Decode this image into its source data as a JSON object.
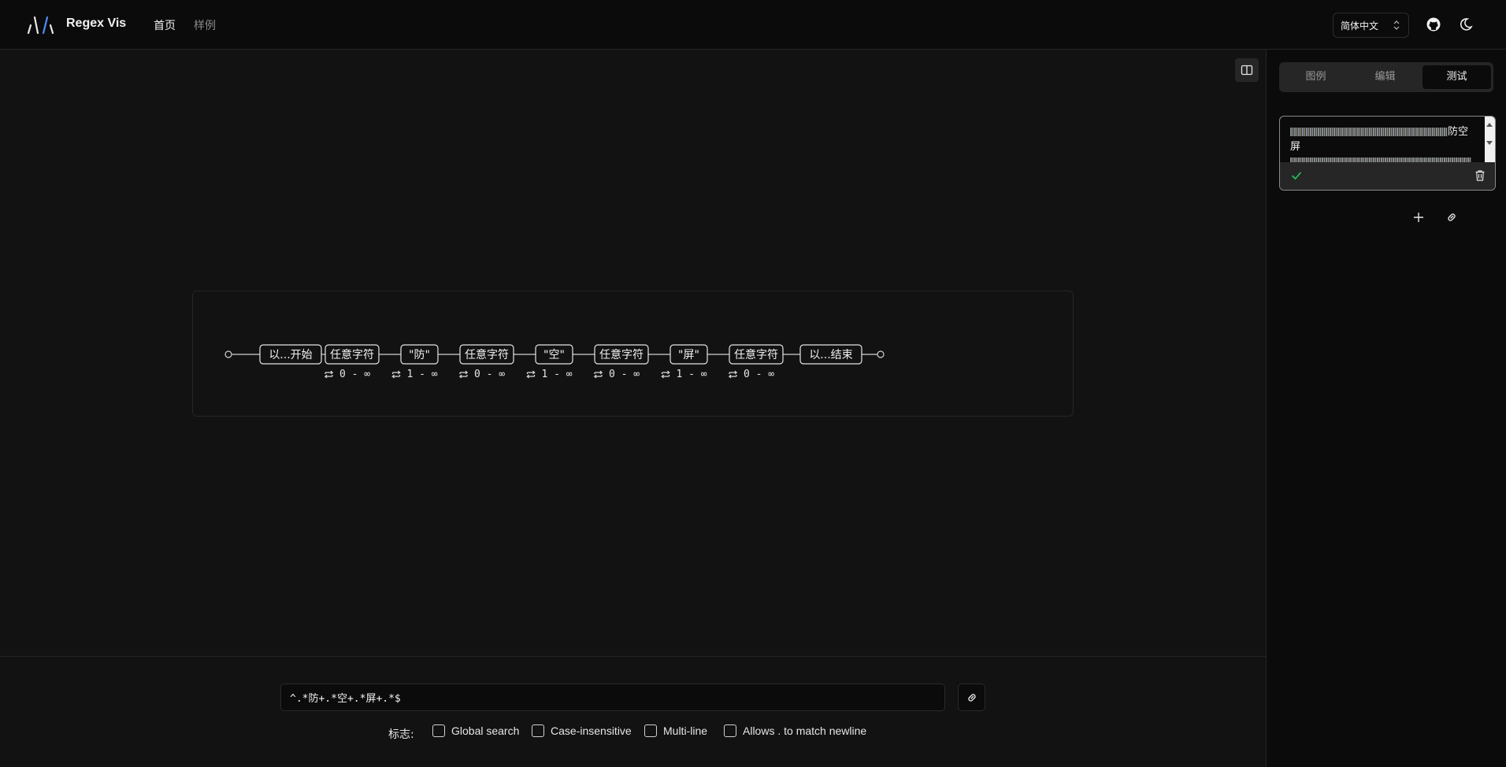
{
  "header": {
    "brand": "Regex Vis",
    "nav": [
      {
        "label": "首页"
      },
      {
        "label": "样例"
      }
    ],
    "language": "简体中文",
    "icons": [
      "logo-icon",
      "github-icon",
      "theme-toggle-icon"
    ]
  },
  "right_panel": {
    "tabs": [
      {
        "label": "图例"
      },
      {
        "label": "编辑"
      },
      {
        "label": "测试"
      }
    ],
    "active_tab": "测试",
    "test_case": {
      "line1_suffix": "防空",
      "line2": "屏",
      "match_status": "matched"
    },
    "accent_color": "#22c55e"
  },
  "diagram": {
    "nodes": [
      {
        "label": "以...开始",
        "quantifier": ""
      },
      {
        "label": "任意字符",
        "quantifier": "0 - ∞"
      },
      {
        "label": "\"防\"",
        "quantifier": "1 - ∞"
      },
      {
        "label": "任意字符",
        "quantifier": "0 - ∞"
      },
      {
        "label": "\"空\"",
        "quantifier": "1 - ∞"
      },
      {
        "label": "任意字符",
        "quantifier": "0 - ∞"
      },
      {
        "label": "\"屏\"",
        "quantifier": "1 - ∞"
      },
      {
        "label": "任意字符",
        "quantifier": "0 - ∞"
      },
      {
        "label": "以...结束",
        "quantifier": ""
      }
    ]
  },
  "editor": {
    "regex": "^.*防+.*空+.*屏+.*$",
    "flags_label": "标志:",
    "flags": [
      {
        "label": "Global search",
        "checked": false
      },
      {
        "label": "Case-insensitive",
        "checked": false
      },
      {
        "label": "Multi-line",
        "checked": false
      },
      {
        "label": "Allows . to match newline",
        "checked": false
      }
    ]
  }
}
